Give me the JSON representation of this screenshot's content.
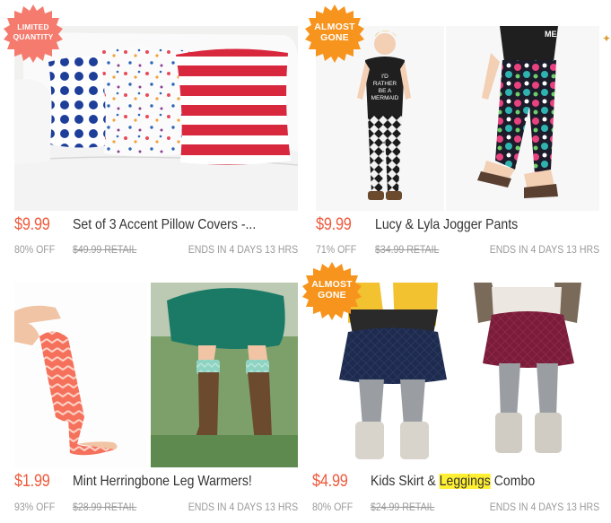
{
  "products": [
    {
      "price": "$9.99",
      "title": "Set of 3 Accent Pillow Covers -...",
      "discount": "80% OFF",
      "retail": "$49.99 RETAIL",
      "ends": "ENDS IN 4 DAYS 13 HRS",
      "badge": [
        "LIMITED",
        "QUANTITY"
      ],
      "badge_color": "#f47b6e"
    },
    {
      "price": "$9.99",
      "title": "Lucy & Lyla Jogger Pants",
      "discount": "71% OFF",
      "retail": "$34.99 RETAIL",
      "ends": "ENDS IN 4 DAYS 13 HRS",
      "badge": [
        "ALMOST",
        "GONE"
      ],
      "badge_color": "#f7941d",
      "shirt_text": "I'D RATHER BE A MERMAID"
    },
    {
      "price": "$1.99",
      "title": "Mint Herringbone Leg Warmers!",
      "discount": "93% OFF",
      "retail": "$28.99 RETAIL",
      "ends": "ENDS IN 4 DAYS 13 HRS"
    },
    {
      "price": "$4.99",
      "title_before": "Kids Skirt & ",
      "title_highlight": "Leggings",
      "title_after": " Combo",
      "discount": "80% OFF",
      "retail": "$24.99 RETAIL",
      "ends": "ENDS IN 4 DAYS 13 HRS",
      "badge": [
        "ALMOST",
        "GONE"
      ],
      "badge_color": "#f7941d"
    }
  ],
  "colors": {
    "price": "#f05a3c",
    "highlight": "#ffef33",
    "meta": "#9a9a9a"
  }
}
